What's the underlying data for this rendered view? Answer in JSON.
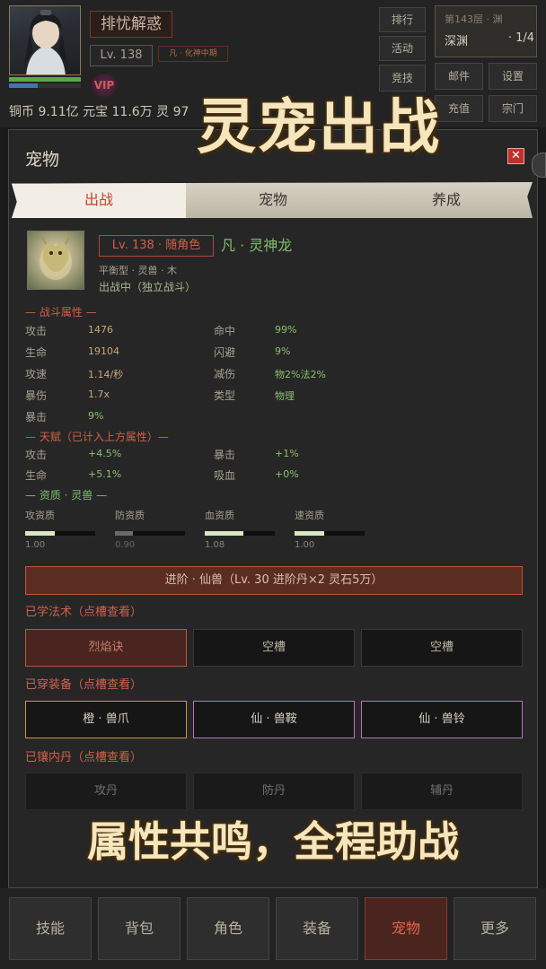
{
  "hud": {
    "player_name": "排忧解惑",
    "level": "Lv. 138",
    "realm": "凡 · 化神中期",
    "vip_label": "VIP",
    "currency_line": "铜币  9.11亿    元宝  11.6万    灵  97",
    "hp_fraction": 1.0,
    "mp_fraction": 0.4,
    "buttons": {
      "rank": "排行",
      "activity": "活动",
      "compete": "竞技",
      "mail": "邮件",
      "settings": "设置",
      "recharge": "充值",
      "sect": "宗门"
    },
    "floor": {
      "line1": "第143层 · 渊",
      "line2_left": "深渊",
      "line2_right": "·  1/4"
    }
  },
  "banners": {
    "top": "灵宠出战",
    "bottom": "属性共鸣，全程助战"
  },
  "panel": {
    "title": "宠物",
    "close": "✕",
    "tabs": [
      "出战",
      "宠物",
      "养成"
    ],
    "active_tab": 0,
    "pet": {
      "level_tag": "Lv. 138 · 随角色",
      "name": "凡 · 灵神龙",
      "type_line": "平衡型  ·  灵兽  ·  木",
      "status": "出战中（独立战斗）"
    },
    "combat": {
      "heading": "— 战斗属性 —",
      "stats": [
        {
          "label": "攻击",
          "value": "1476"
        },
        {
          "label": "命中",
          "value": "99%"
        },
        {
          "label": "生命",
          "value": "19104"
        },
        {
          "label": "闪避",
          "value": "9%"
        },
        {
          "label": "攻速",
          "value": "1.14/秒"
        },
        {
          "label": "减伤",
          "value": "物2%法2%"
        },
        {
          "label": "暴伤",
          "value": "1.7x"
        },
        {
          "label": "类型",
          "value": "物理"
        },
        {
          "label": "暴击",
          "value": "9%"
        }
      ]
    },
    "talent": {
      "heading": "— 天赋（已计入上方属性）—",
      "stats": [
        {
          "label": "攻击",
          "value": "+4.5%"
        },
        {
          "label": "暴击",
          "value": "+1%"
        },
        {
          "label": "生命",
          "value": "+5.1%"
        },
        {
          "label": "吸血",
          "value": "+0%"
        }
      ]
    },
    "aptitude": {
      "heading": "— 资质 · 灵兽 —",
      "items": [
        {
          "label": "攻资质",
          "value": "1.00",
          "fill": 0.42
        },
        {
          "label": "防资质",
          "value": "0.90",
          "fill": 0.25
        },
        {
          "label": "血资质",
          "value": "1.08",
          "fill": 0.55
        },
        {
          "label": "速资质",
          "value": "1.00",
          "fill": 0.42
        }
      ]
    },
    "advance_button": "进阶  ·  仙兽（Lv. 30 进阶丹×2 灵石5万）",
    "skills": {
      "heading": "已学法术（点槽查看）",
      "slots": [
        "烈焰诀",
        "空槽",
        "空槽"
      ]
    },
    "equipment": {
      "heading": "已穿装备（点槽查看）",
      "slots": [
        "橙 · 兽爪",
        "仙 · 兽鞍",
        "仙 · 兽铃"
      ]
    },
    "cores": {
      "heading": "已镶内丹（点槽查看）",
      "slots": [
        "攻丹",
        "防丹",
        "辅丹"
      ]
    }
  },
  "bottom_nav": [
    "技能",
    "背包",
    "角色",
    "装备",
    "宠物",
    "更多"
  ],
  "active_nav": 4
}
